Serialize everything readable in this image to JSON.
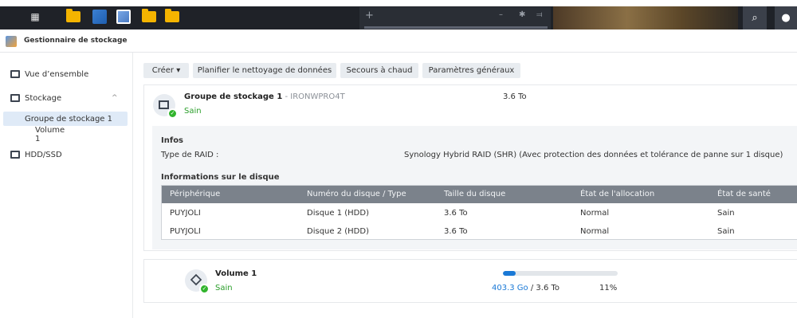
{
  "taskbar": {
    "launcher_icon": "grid-icon",
    "apps": [
      "folder-icon",
      "blue-app-icon",
      "storage-manager-icon",
      "folder-icon",
      "folder-icon"
    ],
    "tab_plus": "+",
    "window_controls": [
      "–",
      "✱",
      "⫤"
    ]
  },
  "app": {
    "title": "Gestionnaire de stockage"
  },
  "sidebar": {
    "overview": "Vue d’ensemble",
    "storage": "Stockage",
    "pool": "Groupe de stockage 1",
    "volume": "Volume 1",
    "hdd": "HDD/SSD",
    "chevron": "^"
  },
  "toolbar": {
    "create": "Créer ▾",
    "schedule": "Planifier le nettoyage de données",
    "hotspare": "Secours à chaud",
    "settings": "Paramètres généraux"
  },
  "pool": {
    "name": "Groupe de stockage 1",
    "separator": " - ",
    "model": "IRONWPRO4T",
    "status": "Sain",
    "size": "3.6 To",
    "info_heading": "Infos",
    "raid_label": "Type de RAID :",
    "raid_value": "Synology Hybrid RAID (SHR) (Avec protection des données et tolérance de panne sur 1 disque)",
    "disk_heading": "Informations sur le disque",
    "columns": [
      "Périphérique",
      "Numéro du disque / Type",
      "Taille du disque",
      "État de l'allocation",
      "État de santé"
    ],
    "rows": [
      [
        "PUYJOLI",
        "Disque 1 (HDD)",
        "3.6 To",
        "Normal",
        "Sain"
      ],
      [
        "PUYJOLI",
        "Disque 2 (HDD)",
        "3.6 To",
        "Normal",
        "Sain"
      ]
    ]
  },
  "volume": {
    "name": "Volume 1",
    "status": "Sain",
    "used": "403.3 Go",
    "sep": " / ",
    "total": "3.6 To",
    "percent_text": "11%",
    "percent_value": 11
  },
  "colors": {
    "accent": "#1a79d6",
    "healthy": "#2a9e2a",
    "table_header": "#7b828b"
  }
}
